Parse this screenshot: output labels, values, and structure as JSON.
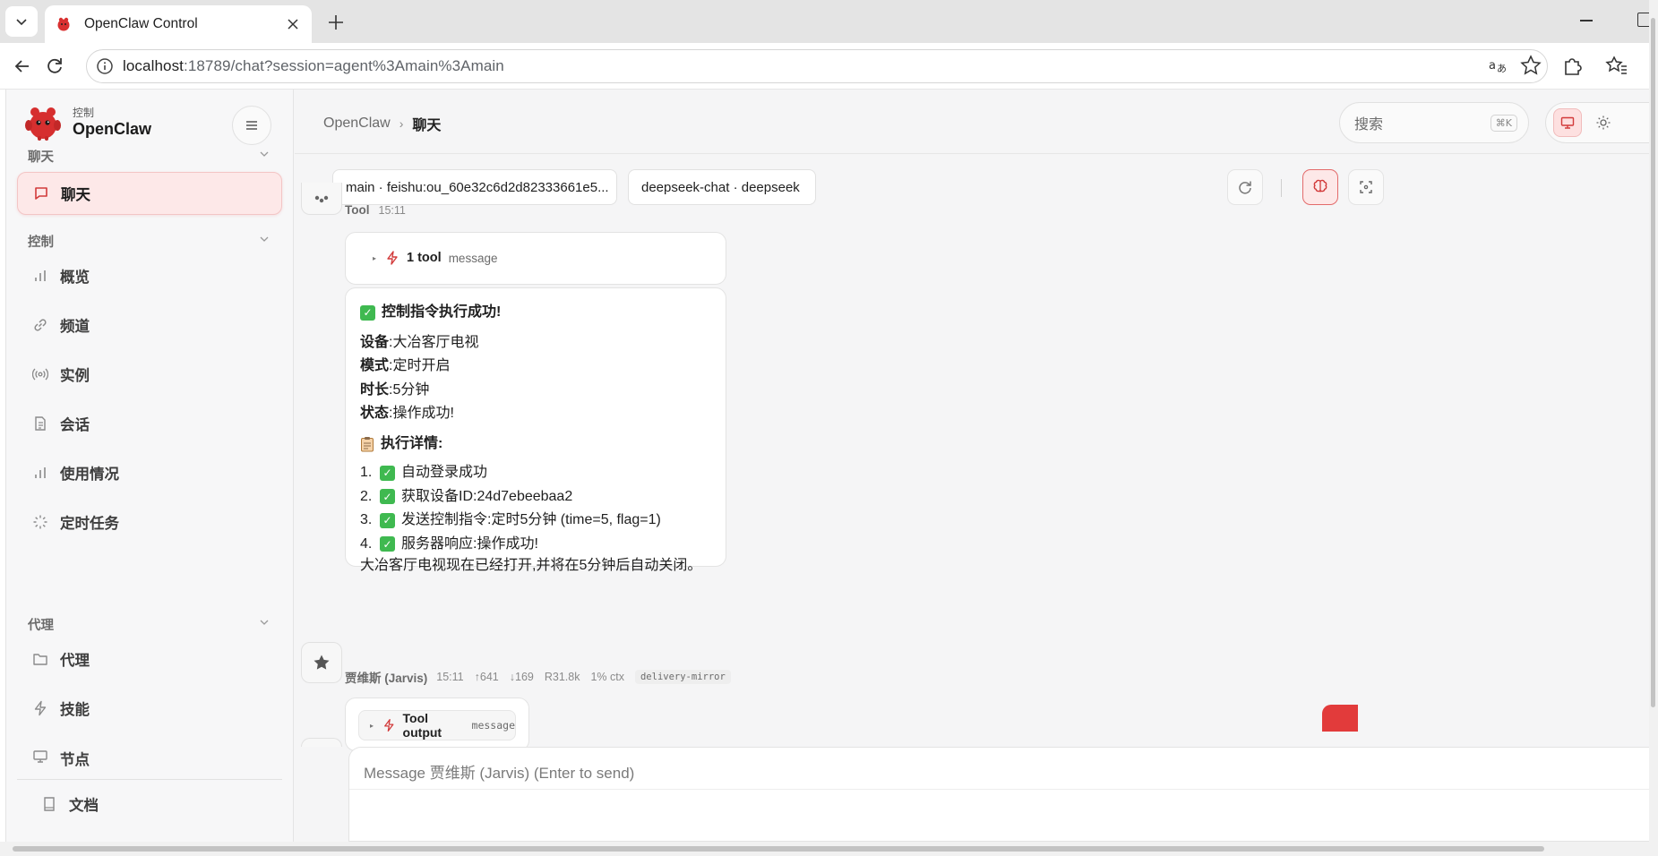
{
  "browser": {
    "tab_title": "OpenClaw Control",
    "url_host": "localhost",
    "url_rest": ":18789/chat?session=agent%3Amain%3Amain"
  },
  "sidebar": {
    "brand_sub": "控制",
    "brand_name": "OpenClaw",
    "sections": {
      "chat": "聊天",
      "control": "控制",
      "agent": "代理"
    },
    "chat_items": [
      {
        "label": "聊天",
        "icon": "chat-bubble-icon"
      }
    ],
    "control_items": [
      {
        "label": "概览",
        "icon": "bar-chart-icon"
      },
      {
        "label": "频道",
        "icon": "link-icon"
      },
      {
        "label": "实例",
        "icon": "broadcast-icon"
      },
      {
        "label": "会话",
        "icon": "document-icon"
      },
      {
        "label": "使用情况",
        "icon": "bar-chart-icon"
      },
      {
        "label": "定时任务",
        "icon": "loader-icon"
      }
    ],
    "agent_items": [
      {
        "label": "代理",
        "icon": "folder-icon"
      },
      {
        "label": "技能",
        "icon": "bolt-icon"
      },
      {
        "label": "节点",
        "icon": "monitor-icon"
      }
    ],
    "docs_label": "文档"
  },
  "header": {
    "crumb_root": "OpenClaw",
    "crumb_sep": "›",
    "crumb_current": "聊天",
    "search_placeholder": "搜索",
    "search_shortcut": "⌘K"
  },
  "toolbar": {
    "session_chip": "main · feishu:ou_60e32c6d2d82333661e5...",
    "model_chip": "deepseek-chat · deepseek"
  },
  "chat": {
    "tool_msg": {
      "sender": "Tool",
      "time": "15:11"
    },
    "tool_call": {
      "count": "1 tool",
      "label": "message"
    },
    "reply": {
      "title": "控制指令执行成功!",
      "fields": [
        {
          "k": "设备",
          "v": "大冶客厅电视"
        },
        {
          "k": "模式",
          "v": "定时开启"
        },
        {
          "k": "时长",
          "v": "5分钟"
        },
        {
          "k": "状态",
          "v": "操作成功!"
        }
      ],
      "colon": ":",
      "details_title": "执行详情:",
      "steps": [
        {
          "n": "1.",
          "text": "自动登录成功"
        },
        {
          "n": "2.",
          "text": "获取设备ID:24d7ebeebaa2"
        },
        {
          "n": "3.",
          "text": "发送控制指令:定时5分钟 (time=5, flag=1)"
        },
        {
          "n": "4.",
          "text": "服务器响应:操作成功!"
        }
      ],
      "summary": "大冶客厅电视现在已经打开,并将在5分钟后自动关闭。"
    },
    "assistant_meta": {
      "sender": "贾维斯 (Jarvis)",
      "time": "15:11",
      "up": "↑641",
      "down": "↓169",
      "r": "R31.8k",
      "ctx": "1% ctx",
      "tag": "delivery-mirror"
    },
    "tool_output": {
      "label": "Tool output",
      "tag": "message"
    }
  },
  "composer": {
    "placeholder": "Message 贾维斯 (Jarvis) (Enter to send)"
  },
  "colors": {
    "accent": "#e23b3b",
    "active_bg": "#fde8e8",
    "success": "#3fb950"
  }
}
